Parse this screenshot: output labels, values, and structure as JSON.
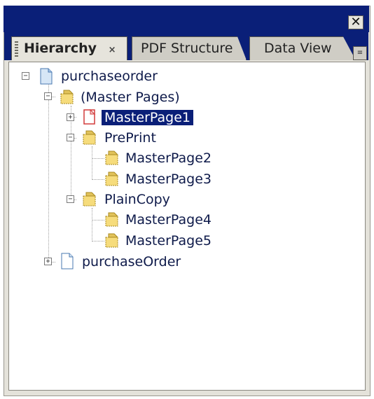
{
  "panel": {
    "close_glyph": "✕",
    "menu_glyph": "≡"
  },
  "tabs": [
    {
      "label": "Hierarchy",
      "close_glyph": "×"
    },
    {
      "label": "PDF Structure"
    },
    {
      "label": "Data View"
    }
  ],
  "tree": {
    "root": {
      "label": "purchaseorder",
      "expander": "−",
      "icon": "document-icon"
    },
    "master_pages": {
      "label": "(Master Pages)",
      "expander": "−",
      "icon": "folder-icon"
    },
    "masterpage1": {
      "label": "MasterPage1",
      "expander": "+",
      "icon": "page-red-icon",
      "selected": true
    },
    "preprint": {
      "label": "PrePrint",
      "expander": "−",
      "icon": "folder-icon"
    },
    "masterpage2": {
      "label": "MasterPage2",
      "icon": "page-gold-icon"
    },
    "masterpage3": {
      "label": "MasterPage3",
      "icon": "page-gold-icon"
    },
    "plaincopy": {
      "label": "PlainCopy",
      "expander": "−",
      "icon": "folder-icon"
    },
    "masterpage4": {
      "label": "MasterPage4",
      "icon": "page-gold-icon"
    },
    "masterpage5": {
      "label": "MasterPage5",
      "icon": "page-gold-icon"
    },
    "purchaseorder_form": {
      "label": "purchaseOrder",
      "expander": "+",
      "icon": "document-icon"
    }
  },
  "colors": {
    "titlebar": "#0a1f78",
    "selection": "#0a1f78",
    "text": "#0e1a4a",
    "folder": "#e1c25a",
    "document": "#a9c7e8",
    "page_red": "#d23a3a"
  }
}
